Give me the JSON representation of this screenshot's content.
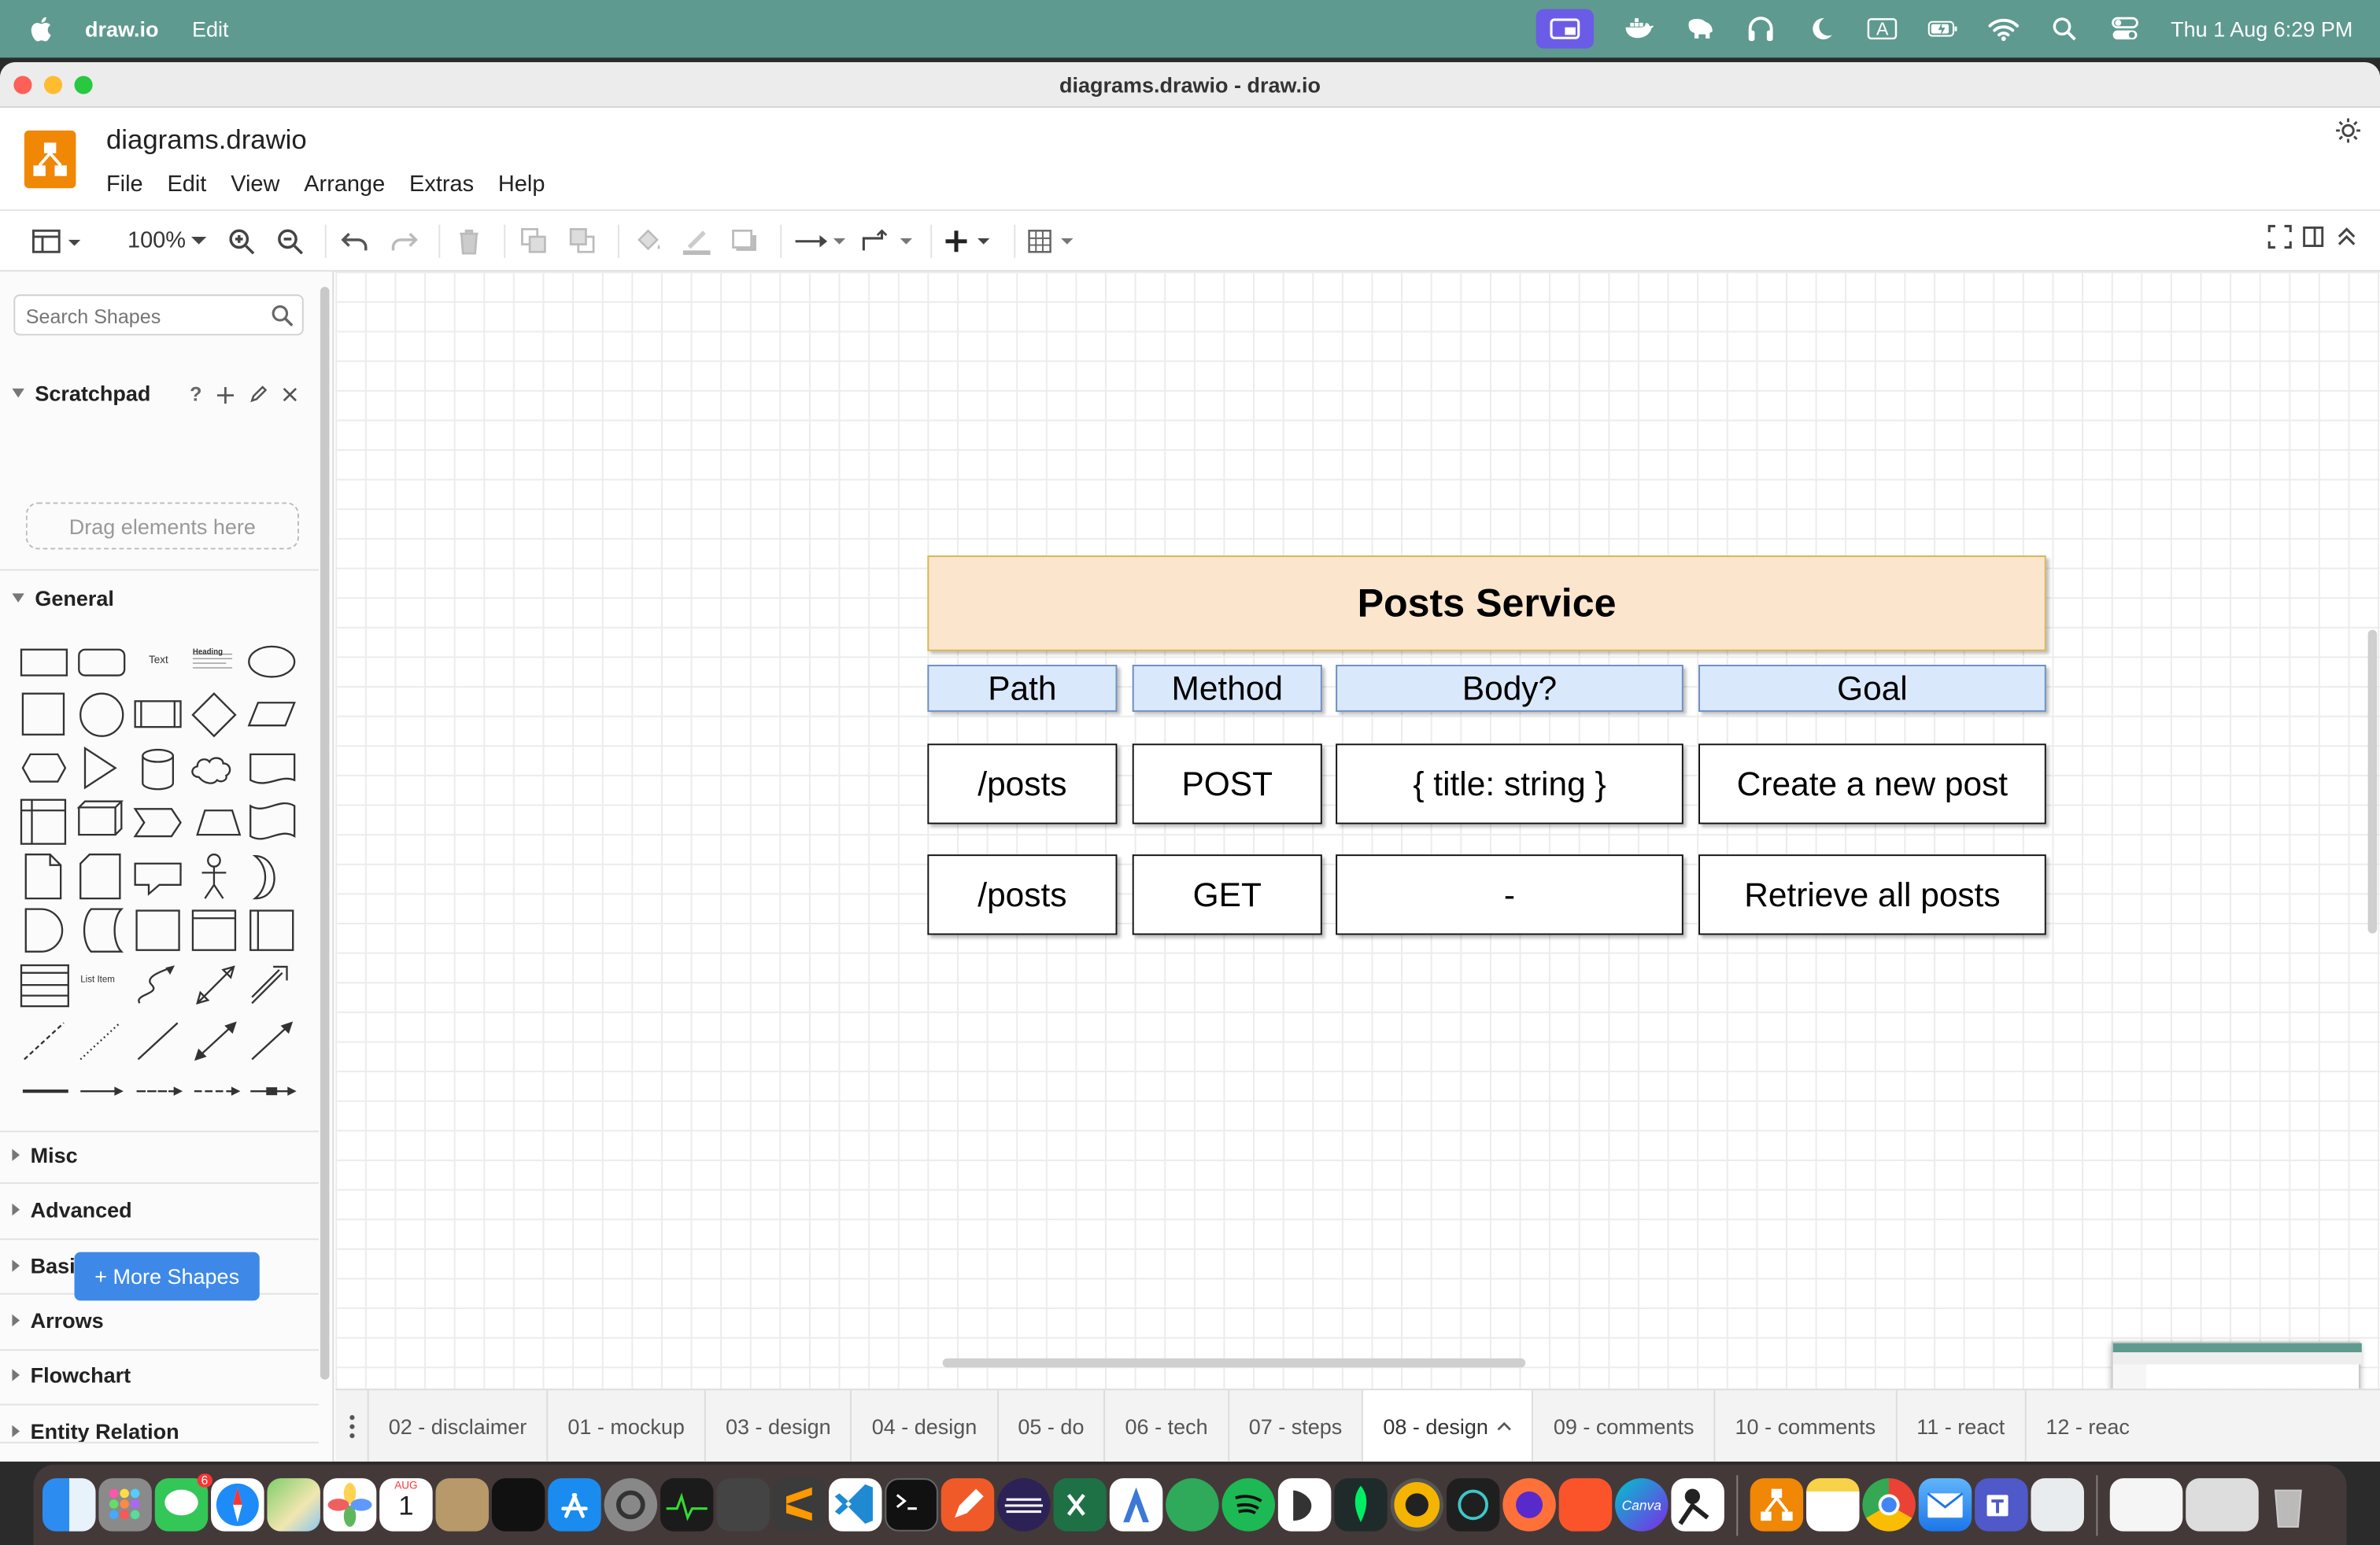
{
  "menubar": {
    "app_name": "draw.io",
    "menu_edit": "Edit",
    "status_icons": [
      "screen-mirror-icon",
      "docker-icon",
      "elephant-icon",
      "headphones-icon",
      "moon-icon",
      "input-source-icon",
      "battery-icon",
      "wifi-icon",
      "spotlight-icon",
      "control-center-icon"
    ],
    "input_source_letter": "A",
    "clock": "Thu 1 Aug  6:29 PM"
  },
  "window": {
    "title": "diagrams.drawio - draw.io"
  },
  "app_header": {
    "filename": "diagrams.drawio",
    "menus": [
      "File",
      "Edit",
      "View",
      "Arrange",
      "Extras",
      "Help"
    ]
  },
  "toolbar": {
    "zoom": "100%"
  },
  "sidebar": {
    "search_placeholder": "Search Shapes",
    "scratchpad_title": "Scratchpad",
    "scratchpad_help": "?",
    "drag_hint": "Drag elements here",
    "general_title": "General",
    "shape_text_label": "Text",
    "shape_heading_label": "Heading",
    "shape_list_item_label": "List Item",
    "sections": [
      "Misc",
      "Advanced",
      "Basic",
      "Arrows",
      "Flowchart",
      "Entity Relation"
    ],
    "more_shapes": "+ More Shapes"
  },
  "diagram": {
    "title": "Posts Service",
    "headers": [
      "Path",
      "Method",
      "Body?",
      "Goal"
    ],
    "rows": [
      [
        "/posts",
        "POST",
        "{ title: string }",
        "Create a new post"
      ],
      [
        "/posts",
        "GET",
        "-",
        "Retrieve all posts"
      ]
    ],
    "colors": {
      "title_fill": "#fce5cd",
      "title_border": "#d6b656",
      "header_fill": "#dae8fc",
      "header_border": "#6c8ebf"
    }
  },
  "page_tabs": {
    "tabs": [
      "02 - disclaimer",
      "01 - mockup",
      "03 - design",
      "04 - design",
      "05 - do",
      "06 - tech",
      "07 - steps",
      "08 - design",
      "09 - comments",
      "10 - comments",
      "11 - react",
      "12 - reac"
    ],
    "active_index": 7
  },
  "dock": {
    "apps": [
      "finder",
      "launchpad",
      "messages",
      "safari",
      "maps",
      "photos",
      "calendar",
      "contacts",
      "apple-tv",
      "app-store",
      "system-settings",
      "activity-monitor",
      "calculator",
      "sublime-text",
      "vscode",
      "terminal",
      "pencil",
      "eclipse",
      "excel",
      "instruments",
      "sourcetree",
      "spotify",
      "tableplus",
      "mongodb-compass",
      "chrome-canary",
      "chatgpt",
      "firefox",
      "brave",
      "canva",
      "xcode-simulator",
      "drawio",
      "notes",
      "chrome",
      "mail",
      "teams",
      "preview",
      "downloads",
      "trash"
    ],
    "messages_badge": "6",
    "calendar_month": "AUG",
    "calendar_day": "1",
    "canva_label": "Canva"
  }
}
